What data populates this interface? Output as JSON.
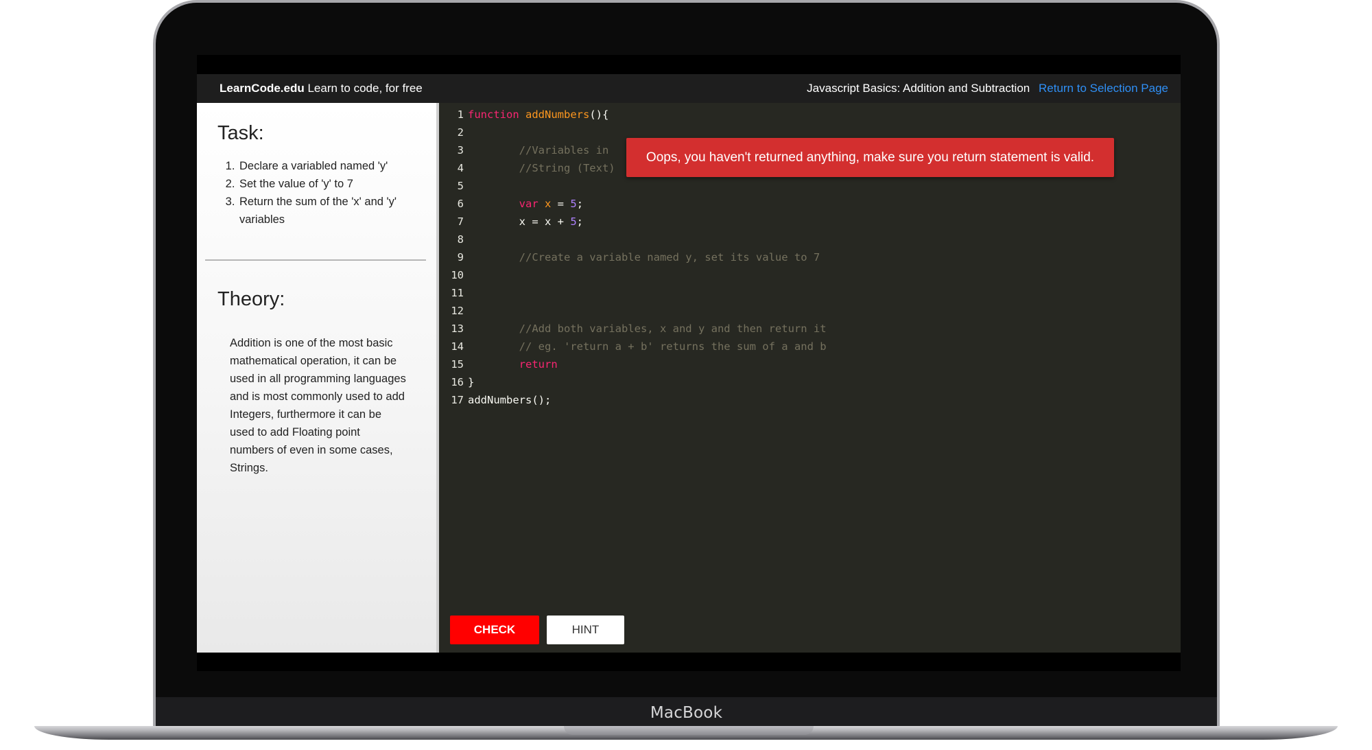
{
  "device": {
    "brand_label": "MacBook"
  },
  "header": {
    "site_name": "LearnCode.edu",
    "tagline": " Learn to code, for free",
    "lesson_title": "Javascript Basics: Addition and Subtraction",
    "return_link": "Return to Selection Page"
  },
  "task": {
    "title": "Task:",
    "steps": [
      "Declare a variabled named 'y'",
      "Set the value of 'y' to 7",
      "Return the sum of the 'x' and 'y' variables"
    ]
  },
  "theory": {
    "title": "Theory:",
    "text": "Addition is one of the most basic mathematical operation, it can be used in all programming languages and is most commonly used to add Integers, furthermore it can be used to add Floating point numbers of even in some cases, Strings."
  },
  "editor": {
    "lines": [
      {
        "n": "1",
        "tokens": [
          {
            "t": "function",
            "c": "kw"
          },
          {
            "t": " ",
            "c": "pl"
          },
          {
            "t": "addNumbers",
            "c": "fn"
          },
          {
            "t": "(){",
            "c": "pl"
          }
        ]
      },
      {
        "n": "2",
        "tokens": []
      },
      {
        "n": "3",
        "tokens": [
          {
            "t": "        //Variables in",
            "c": "cm"
          }
        ]
      },
      {
        "n": "4",
        "tokens": [
          {
            "t": "        //String (Text)",
            "c": "cm"
          }
        ]
      },
      {
        "n": "5",
        "tokens": []
      },
      {
        "n": "6",
        "tokens": [
          {
            "t": "        ",
            "c": "pl"
          },
          {
            "t": "var",
            "c": "kw"
          },
          {
            "t": " ",
            "c": "pl"
          },
          {
            "t": "x",
            "c": "fn"
          },
          {
            "t": " = ",
            "c": "pl"
          },
          {
            "t": "5",
            "c": "num"
          },
          {
            "t": ";",
            "c": "pl"
          }
        ]
      },
      {
        "n": "7",
        "tokens": [
          {
            "t": "        x = x + ",
            "c": "pl"
          },
          {
            "t": "5",
            "c": "num"
          },
          {
            "t": ";",
            "c": "pl"
          }
        ]
      },
      {
        "n": "8",
        "tokens": []
      },
      {
        "n": "9",
        "tokens": [
          {
            "t": "        //Create a variable named y, set its value to 7",
            "c": "cm"
          }
        ]
      },
      {
        "n": "10",
        "tokens": []
      },
      {
        "n": "11",
        "tokens": []
      },
      {
        "n": "12",
        "tokens": []
      },
      {
        "n": "13",
        "tokens": [
          {
            "t": "        //Add both variables, x and y and then return it",
            "c": "cm"
          }
        ]
      },
      {
        "n": "14",
        "tokens": [
          {
            "t": "        // eg. 'return a + b' returns the sum of a and b",
            "c": "cm"
          }
        ]
      },
      {
        "n": "15",
        "tokens": [
          {
            "t": "        ",
            "c": "pl"
          },
          {
            "t": "return",
            "c": "kw"
          }
        ]
      },
      {
        "n": "16",
        "tokens": [
          {
            "t": "}",
            "c": "pl"
          }
        ]
      },
      {
        "n": "17",
        "tokens": [
          {
            "t": "addNumbers();",
            "c": "pl"
          }
        ]
      }
    ],
    "error_message": "Oops, you haven't returned anything, make sure you return statement is valid.",
    "check_label": "CHECK",
    "hint_label": "HINT"
  },
  "colors": {
    "error_bg": "#d32f2f",
    "check_bg": "#ff0000",
    "link": "#2f8ff5",
    "editor_bg": "#272822",
    "keyword": "#f92672",
    "function_name": "#fd971f",
    "number": "#ae81ff",
    "comment": "#75715e"
  }
}
